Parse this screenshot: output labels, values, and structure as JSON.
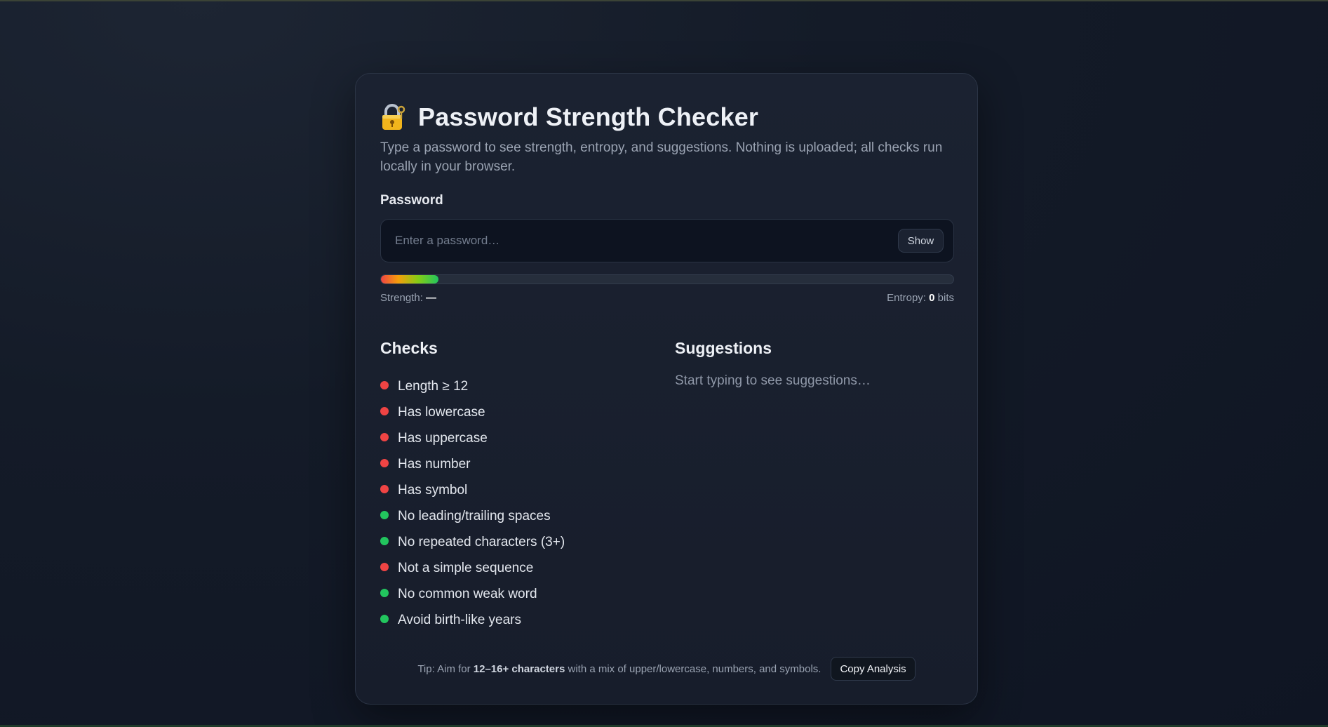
{
  "app": {
    "title": "Password Strength Checker",
    "subtitle": "Type a password to see strength, entropy, and suggestions. Nothing is uploaded; all checks run locally in your browser."
  },
  "password": {
    "label": "Password",
    "value": "",
    "placeholder": "Enter a password…",
    "show_label": "Show"
  },
  "meter": {
    "fill_fraction": 0.1,
    "strength_label": "Strength:",
    "strength_value": "—",
    "entropy_label": "Entropy:",
    "entropy_value": "0",
    "entropy_unit": "bits"
  },
  "checks": {
    "title": "Checks",
    "items": [
      {
        "label": "Length ≥ 12",
        "status": "fail"
      },
      {
        "label": "Has lowercase",
        "status": "fail"
      },
      {
        "label": "Has uppercase",
        "status": "fail"
      },
      {
        "label": "Has number",
        "status": "fail"
      },
      {
        "label": "Has symbol",
        "status": "fail"
      },
      {
        "label": "No leading/trailing spaces",
        "status": "pass"
      },
      {
        "label": "No repeated characters (3+)",
        "status": "pass"
      },
      {
        "label": "Not a simple sequence",
        "status": "fail"
      },
      {
        "label": "No common weak word",
        "status": "pass"
      },
      {
        "label": "Avoid birth-like years",
        "status": "pass"
      }
    ]
  },
  "suggestions": {
    "title": "Suggestions",
    "empty_text": "Start typing to see suggestions…"
  },
  "footer": {
    "tip_prefix": "Tip: Aim for ",
    "tip_bold": "12–16+ characters",
    "tip_suffix": " with a mix of upper/lowercase, numbers, and symbols.",
    "copy_label": "Copy Analysis"
  },
  "colors": {
    "fail": "#ef4444",
    "pass": "#22c55e",
    "background": "#141b28",
    "card": "#1b2231"
  },
  "icons": {
    "title_icon": "lock-with-key-icon"
  }
}
